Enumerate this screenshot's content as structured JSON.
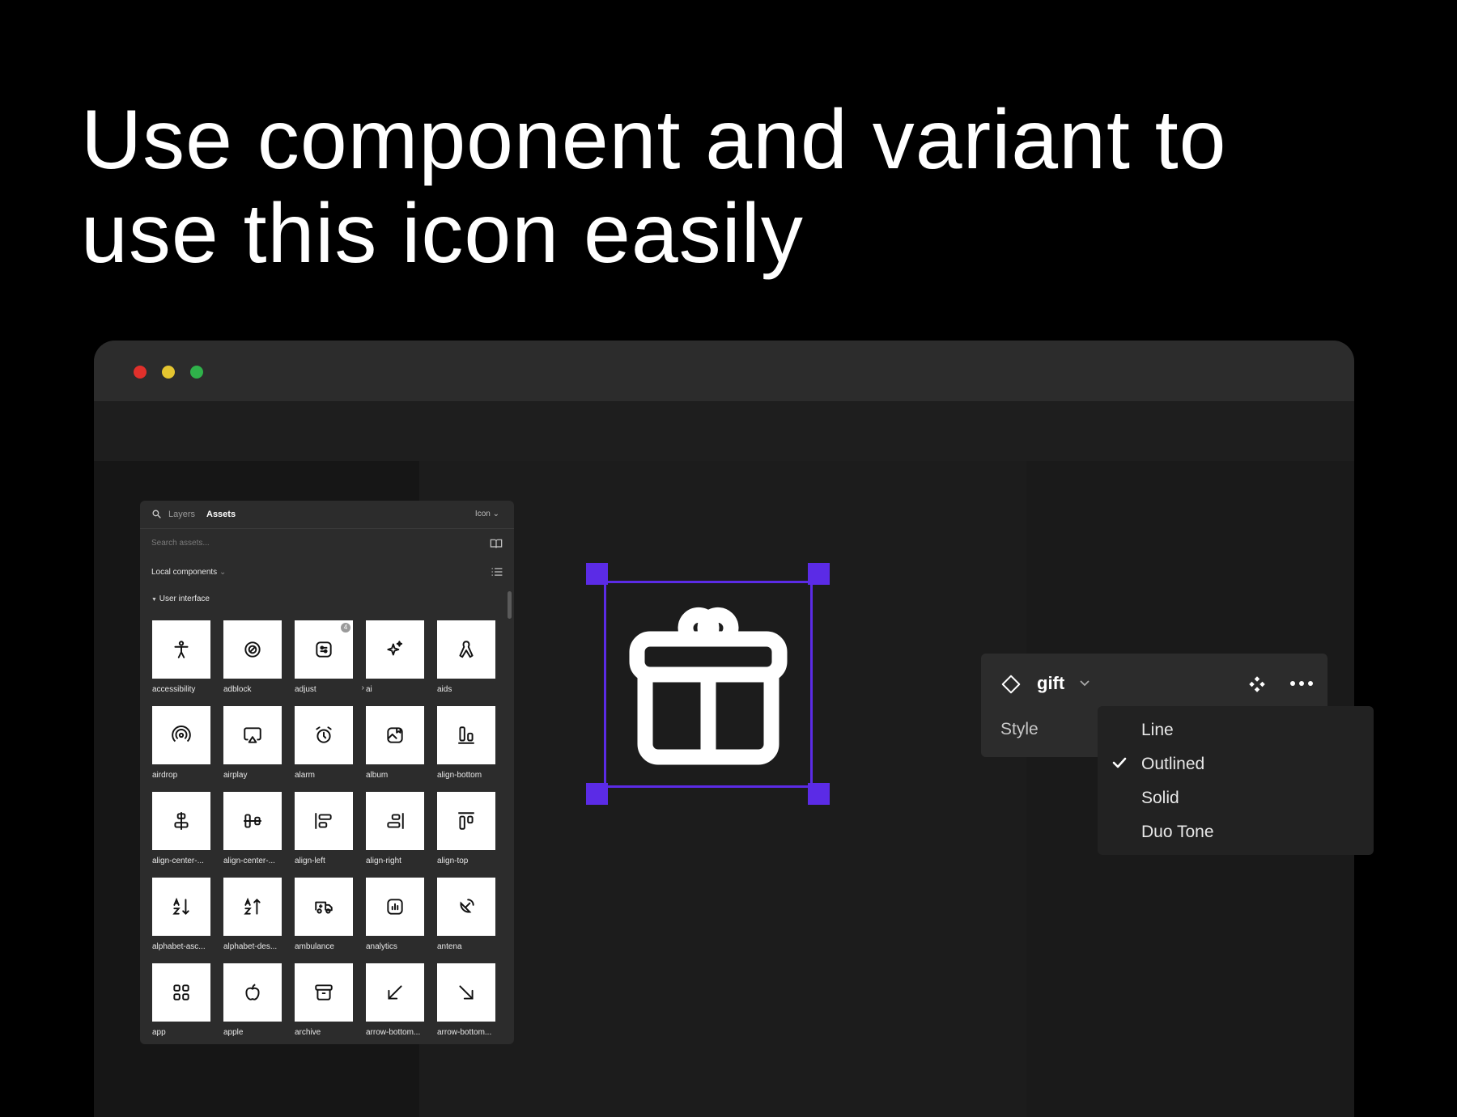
{
  "headline": {
    "line1": "Use component and variant to",
    "line2": "use this icon easily"
  },
  "assets_panel": {
    "tabs": [
      "Layers",
      "Assets"
    ],
    "active_tab": "Assets",
    "library_select": "Icon",
    "search_placeholder": "Search assets...",
    "section_label": "Local components",
    "group_label": "User interface",
    "items": [
      {
        "label": "accessibility",
        "icon": "accessibility-icon"
      },
      {
        "label": "adblock",
        "icon": "adblock-icon"
      },
      {
        "label": "adjust",
        "icon": "adjust-icon",
        "badge": "4"
      },
      {
        "label": "ai",
        "icon": "ai-sparkle-icon"
      },
      {
        "label": "aids",
        "icon": "aids-ribbon-icon"
      },
      {
        "label": "airdrop",
        "icon": "airdrop-icon"
      },
      {
        "label": "airplay",
        "icon": "airplay-icon"
      },
      {
        "label": "alarm",
        "icon": "alarm-icon"
      },
      {
        "label": "album",
        "icon": "album-icon"
      },
      {
        "label": "align-bottom",
        "icon": "align-bottom-icon"
      },
      {
        "label": "align-center-...",
        "icon": "align-center-horizontal-icon"
      },
      {
        "label": "align-center-...",
        "icon": "align-center-vertical-icon"
      },
      {
        "label": "align-left",
        "icon": "align-left-icon"
      },
      {
        "label": "align-right",
        "icon": "align-right-icon"
      },
      {
        "label": "align-top",
        "icon": "align-top-icon"
      },
      {
        "label": "alphabet-asc...",
        "icon": "alphabet-ascending-icon"
      },
      {
        "label": "alphabet-des...",
        "icon": "alphabet-descending-icon"
      },
      {
        "label": "ambulance",
        "icon": "ambulance-icon"
      },
      {
        "label": "analytics",
        "icon": "analytics-icon"
      },
      {
        "label": "antena",
        "icon": "antena-icon"
      },
      {
        "label": "app",
        "icon": "app-grid-icon"
      },
      {
        "label": "apple",
        "icon": "apple-icon"
      },
      {
        "label": "archive",
        "icon": "archive-icon"
      },
      {
        "label": "arrow-bottom...",
        "icon": "arrow-bottom-left-icon"
      },
      {
        "label": "arrow-bottom...",
        "icon": "arrow-bottom-right-icon"
      }
    ]
  },
  "canvas": {
    "selected_icon": "gift-icon",
    "selection_color": "#5b2be6"
  },
  "properties": {
    "component_name": "gift",
    "property_label": "Style",
    "style_options": [
      "Line",
      "Outlined",
      "Solid",
      "Duo Tone"
    ],
    "selected_style": "Outlined"
  }
}
